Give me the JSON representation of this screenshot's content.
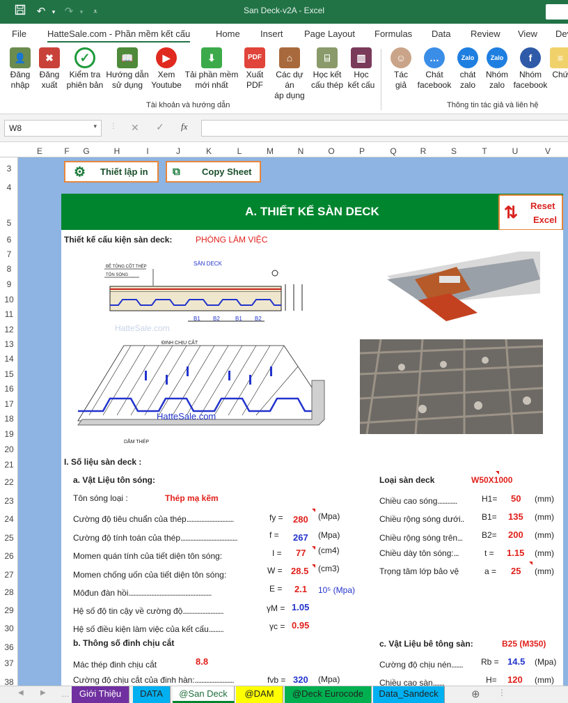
{
  "window": {
    "title": "San Deck-v2A  -  Excel"
  },
  "menu": {
    "tabs": [
      "File",
      "HatteSale.com - Phần mềm kết cấu",
      "Home",
      "Insert",
      "Page Layout",
      "Formulas",
      "Data",
      "Review",
      "View",
      "Dev"
    ]
  },
  "ribbon": {
    "buttons": [
      {
        "l1": "Đăng",
        "l2": "nhập",
        "icon": "user-login-icon"
      },
      {
        "l1": "Đăng",
        "l2": "xuất",
        "icon": "user-logout-icon"
      },
      {
        "l1": "Kiểm tra",
        "l2": "phiên bản",
        "icon": "checkmark-icon"
      },
      {
        "l1": "Hướng dẫn",
        "l2": "sử dụng",
        "icon": "book-icon"
      },
      {
        "l1": "Xem",
        "l2": "Youtube",
        "icon": "youtube-icon"
      },
      {
        "l1": "Tải phần mềm",
        "l2": "mới nhất",
        "icon": "download-icon"
      },
      {
        "l1": "Xuất",
        "l2": "PDF",
        "icon": "pdf-icon"
      },
      {
        "l1": "Các dự án",
        "l2": "áp dụng",
        "icon": "house-icon"
      },
      {
        "l1": "Học kết",
        "l2": "cấu thép",
        "icon": "steel-frame-icon"
      },
      {
        "l1": "Học",
        "l2": "kết cấu",
        "icon": "building-icon"
      },
      {
        "l1": "Tác",
        "l2": "giả",
        "icon": "author-photo-icon"
      },
      {
        "l1": "Chát",
        "l2": "facebook",
        "icon": "messenger-icon"
      },
      {
        "l1": "chát",
        "l2": "zalo",
        "icon": "zalo-icon"
      },
      {
        "l1": "Nhóm",
        "l2": "zalo",
        "icon": "zalo-group-icon"
      },
      {
        "l1": "Nhóm",
        "l2": "facebook",
        "icon": "facebook-group-icon"
      },
      {
        "l1": "Chứ",
        "l2": "",
        "icon": "certificate-icon"
      }
    ],
    "group1": "Tài khoản và hướng dẫn",
    "group2": "Thông tin tác giả và liên hệ"
  },
  "formula": {
    "namebox": "W8",
    "fx": "fx",
    "value": ""
  },
  "columns": [
    "E",
    "F",
    "G",
    "H",
    "I",
    "J",
    "K",
    "L",
    "M",
    "N",
    "O",
    "P",
    "Q",
    "R",
    "S",
    "T",
    "U",
    "V"
  ],
  "rows": [
    "3",
    "4",
    "5",
    "6",
    "7",
    "8",
    "9",
    "10",
    "11",
    "12",
    "13",
    "14",
    "15",
    "16",
    "17",
    "18",
    "19",
    "20",
    "21",
    "22",
    "23",
    "24",
    "25",
    "26",
    "27",
    "28",
    "29",
    "30",
    "36",
    "37",
    "38"
  ],
  "sheet": {
    "btn_print": "Thiết lập in",
    "btn_copy": "Copy Sheet",
    "banner": "A. THIẾT KẾ SÀN DECK",
    "reset1": "Reset",
    "reset2": "Excel",
    "design_label": "Thiết kế cấu kiện sàn deck:",
    "design_value": "PHÒNG LÀM VIỆC",
    "watermark1": "HatteSale.com",
    "watermark2": "HatteSale.com",
    "dwg_lbl1": "BÊ TÔNG CỐT THÉP",
    "dwg_lbl2": "TÔN SÓNG",
    "dwg_lbl3": "SÀN DECK",
    "dwg_lbl4": "ĐINH CHỊU CẮT",
    "dwg_lbl5": "DẦM THÉP",
    "dwg_b1": "B1",
    "dwg_b2": "B2",
    "dwg_b3": "B1",
    "dwg_b4": "B2",
    "sec1": "I.  Số liệu sàn deck :",
    "sub_a": "a. Vật Liệu tôn sóng:",
    "ton_song_lbl": "Tôn sóng loại :",
    "ton_song_val": "Thép mạ kẽm",
    "fy_lbl": "Cường độ tiêu chuẩn của thép",
    "fy_sym": "fy =",
    "fy_val": "280",
    "fy_unit": "(Mpa)",
    "f_lbl": "Cường độ tính toán của thép",
    "f_sym": "f  =",
    "f_val": "267",
    "f_unit": "(Mpa)",
    "I_lbl": "Momen quán tính của tiết diện tôn sóng:",
    "I_sym": "I =",
    "I_val": "77",
    "I_unit": "(cm4)",
    "W_lbl": "Momen chống uốn của tiết diện tôn sóng:",
    "W_sym": "W =",
    "W_val": "28.5",
    "W_unit": "(cm3)",
    "E_lbl": "Môđun đàn hồi",
    "E_sym": "E =",
    "E_val": "2.1",
    "E_unit": "10⁵ (Mpa)",
    "gm_lbl": "Hệ số độ tin cậy về cường độ",
    "gm_sym": "γM =",
    "gm_val": "1.05",
    "gc_lbl": "Hệ số điều kiện làm việc của kết cấu",
    "gc_sym": "γc =",
    "gc_val": "0.95",
    "sub_b": "b. Thông số đinh chịu cắt",
    "mac_lbl": "Mác thép đinh chịu cắt",
    "mac_val": "8.8",
    "fvb_lbl": "Cường độ chịu cắt của  đinh hàn:",
    "fvb_sym": "fvb =",
    "fvb_val": "320",
    "fvb_unit": "(Mpa)",
    "loai_lbl": "Loại sàn deck",
    "loai_val": "W50X1000",
    "h1_lbl": "Chiều cao sóng",
    "h1_sym": "H1=",
    "h1_val": "50",
    "h1_unit": "(mm)",
    "b1_lbl": "Chiều rộng sóng dưới",
    "b1_sym": "B1=",
    "b1_val": "135",
    "b1_unit": "(mm)",
    "b2_lbl": "Chiều rộng sóng trên",
    "b2_sym": "B2=",
    "b2_val": "200",
    "b2_unit": "(mm)",
    "t_lbl": "Chiều dày tôn sóng:",
    "t_sym": "t =",
    "t_val": "1.15",
    "t_unit": "(mm)",
    "a_lbl": "Trọng tâm lớp bảo vệ",
    "a_sym": "a =",
    "a_val": "25",
    "a_unit": "(mm)",
    "sub_c": "c. Vật Liệu bê tông sàn:",
    "conc_val": "B25 (M350)",
    "rb_lbl": "Cường độ chịu nén",
    "rb_sym": "Rb =",
    "rb_val": "14.5",
    "rb_unit": "(Mpa)",
    "hc_lbl": "Chiều cao sàn",
    "hc_sym": "H=",
    "hc_val": "120",
    "hc_unit": "(mm)"
  },
  "sheettabs": [
    "Giới Thiệu",
    "DATA",
    "@San Deck",
    "@DAM",
    "@Deck Eurocode",
    "Data_Sandeck"
  ],
  "colors": {
    "excel_green": "#217346",
    "banner_green": "#00852f",
    "sheet_blue": "#8db4e2",
    "value_red": "#e0201b",
    "value_blue": "#2233cc"
  }
}
